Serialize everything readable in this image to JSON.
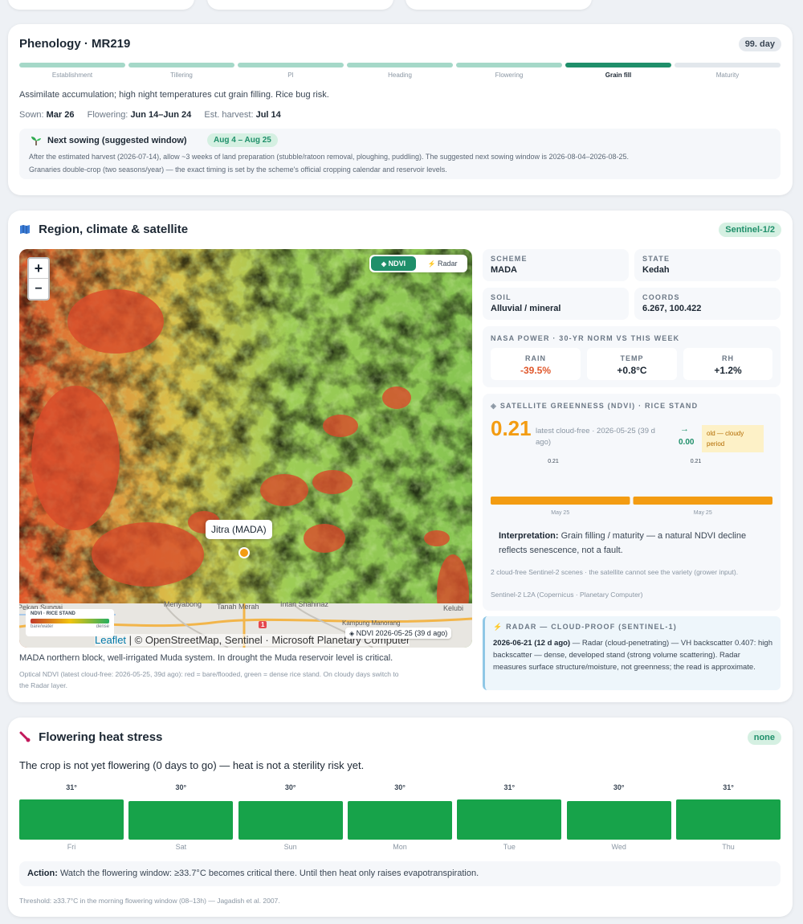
{
  "phenology": {
    "title": "Phenology · MR219",
    "day_badge": "99. day",
    "stages": [
      {
        "label": "Establishment",
        "state": "done"
      },
      {
        "label": "Tillering",
        "state": "done"
      },
      {
        "label": "PI",
        "state": "done"
      },
      {
        "label": "Heading",
        "state": "done"
      },
      {
        "label": "Flowering",
        "state": "done"
      },
      {
        "label": "Grain fill",
        "state": "current"
      },
      {
        "label": "Maturity",
        "state": "future"
      }
    ],
    "description": "Assimilate accumulation; high night temperatures cut grain filling. Rice bug risk.",
    "sown_label": "Sown:",
    "sown_value": "Mar 26",
    "flowering_label": "Flowering:",
    "flowering_value": "Jun 14–Jun 24",
    "harvest_label": "Est. harvest:",
    "harvest_value": "Jul 14",
    "next_sowing": {
      "icon": "seedling-icon",
      "title": "Next sowing (suggested window)",
      "window": "Aug 4 – Aug 25",
      "line1": "After the estimated harvest (2026-07-14), allow ~3 weeks of land preparation (stubble/ratoon removal, ploughing, puddling). The suggested next sowing window is 2026-08-04–2026-08-25.",
      "line2": "Granaries double-crop (two seasons/year) — the exact timing is set by the scheme's official cropping calendar and reservoir levels."
    }
  },
  "region": {
    "title": "Region, climate & satellite",
    "title_icon": "map-icon",
    "badge": "Sentinel-1/2",
    "map": {
      "zoom_in": "+",
      "zoom_out": "−",
      "layer_ndvi": "NDVI",
      "layer_radar": "Radar",
      "marker_label": "Jitra (MADA)",
      "legend_title": "NDVI · RICE STAND",
      "legend_low": "bare/water",
      "legend_high": "dense",
      "place_names": [
        "Pekan Sungai",
        "Menyabong",
        "Tanah Merah",
        "Intan Shahinaz",
        "Kelubi",
        "Kampung Manorang"
      ],
      "road_number": "1",
      "ndvi_stamp": "NDVI 2026-05-25 (39 d ago)",
      "attribution_leaflet": "Leaflet",
      "attribution_rest": " | © OpenStreetMap, Sentinel · Microsoft Planetary Computer"
    },
    "map_caption": "MADA northern block, well-irrigated Muda system. In drought the Muda reservoir level is critical.",
    "map_note_1": "Optical NDVI (latest cloud-free: 2026-05-25, 39d ago): red = bare/flooded, green = dense rice stand. On cloudy days switch to",
    "map_note_2": "the  Radar layer.",
    "scheme_label": "SCHEME",
    "scheme_value": "MADA",
    "state_label": "STATE",
    "state_value": "Kedah",
    "soil_label": "SOIL",
    "soil_value": "Alluvial / mineral",
    "coords_label": "COORDS",
    "coords_value": "6.267, 100.422",
    "climate": {
      "title": "NASA POWER · 30-YR NORM VS THIS WEEK",
      "rain_label": "RAIN",
      "rain_value": "-39.5%",
      "rain_color": "#e0582c",
      "temp_label": "TEMP",
      "temp_value": "+0.8°C",
      "rh_label": "RH",
      "rh_value": "+1.2%"
    },
    "ndvi": {
      "title": "SATELLITE GREENNESS (NDVI) · RICE STAND",
      "value": "0.21",
      "sub": "latest cloud-free · 2026-05-25 (39 d ago)",
      "arrow": "→",
      "delta": "0.00",
      "warning": "old — cloudy period",
      "bar_values": [
        0.21,
        0.21
      ],
      "bar_value_labels": [
        "0.21",
        "0.21"
      ],
      "bar_dates": [
        "May 25",
        "May 25"
      ],
      "bar_color": "#f39c12",
      "interp_label": "Interpretation:",
      "interp_text": " Grain filling / maturity — a natural NDVI decline reflects senescence, not a fault.",
      "footnote1": "2 cloud-free Sentinel-2 scenes · the satellite cannot see the variety (grower input).",
      "footnote2": "Sentinel-2 L2A (Copernicus · Planetary Computer)"
    },
    "radar": {
      "title": "RADAR — CLOUD-PROOF (SENTINEL-1)",
      "date": "2026-06-21 (12 d ago)",
      "text": " — Radar (cloud-penetrating) — VH backscatter 0.407: high backscatter — dense, developed stand (strong volume scattering). Radar measures surface structure/moisture, not greenness; the read is approximate."
    }
  },
  "heat": {
    "title": "Flowering heat stress",
    "title_icon": "thermometer-icon",
    "badge": "none",
    "summary": "The crop is not yet flowering (0 days to go) — heat is not a sterility risk yet.",
    "days": [
      {
        "day": "Fri",
        "temp": 31,
        "label": "31°"
      },
      {
        "day": "Sat",
        "temp": 30,
        "label": "30°"
      },
      {
        "day": "Sun",
        "temp": 30,
        "label": "30°"
      },
      {
        "day": "Mon",
        "temp": 30,
        "label": "30°"
      },
      {
        "day": "Tue",
        "temp": 31,
        "label": "31°"
      },
      {
        "day": "Wed",
        "temp": 30,
        "label": "30°"
      },
      {
        "day": "Thu",
        "temp": 31,
        "label": "31°"
      }
    ],
    "bar_color": "#17a34a",
    "action_label": "Action:",
    "action_text": " Watch the flowering window: ≥33.7°C becomes critical there. Until then heat only raises evapotranspiration.",
    "threshold": "Threshold: ≥33.7°C in the morning flowering window (08–13h) — Jagadish et al. 2007."
  }
}
